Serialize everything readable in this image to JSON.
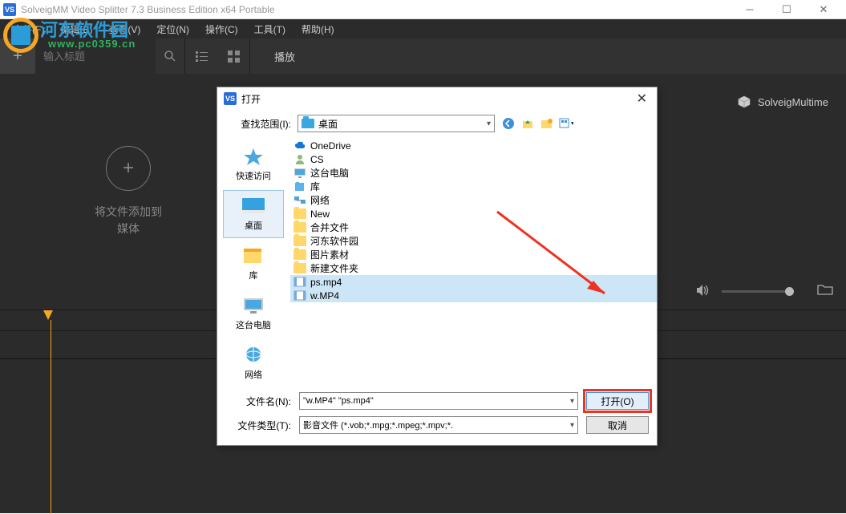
{
  "window": {
    "title": "SolveigMM Video Splitter 7.3 Business Edition x64 Portable"
  },
  "watermark": {
    "text1": "河东软件园",
    "text2": "www.pc0359.cn"
  },
  "menu": {
    "file": "文件(F)",
    "edit": "编辑(E)",
    "view": "查看(V)",
    "navigate": "定位(N)",
    "control": "操作(C)",
    "tools": "工具(T)",
    "help": "帮助(H)"
  },
  "toolbar": {
    "title_placeholder": "输入标题",
    "play": "播放"
  },
  "media": {
    "add_line1": "将文件添加到",
    "add_line2": "媒体"
  },
  "brand": "SolveigMultime",
  "dialog": {
    "title": "打开",
    "lookin_label": "查找范围(I):",
    "lookin_value": "桌面",
    "sidebar": {
      "quick": "快速访问",
      "desktop": "桌面",
      "library": "库",
      "pc": "这台电脑",
      "network": "网络"
    },
    "items": [
      {
        "name": "OneDrive",
        "type": "cloud"
      },
      {
        "name": "CS",
        "type": "user"
      },
      {
        "name": "这台电脑",
        "type": "pc"
      },
      {
        "name": "库",
        "type": "lib"
      },
      {
        "name": "网络",
        "type": "net"
      },
      {
        "name": "New",
        "type": "folder"
      },
      {
        "name": "合并文件",
        "type": "folder"
      },
      {
        "name": "河东软件园",
        "type": "folder"
      },
      {
        "name": "图片素材",
        "type": "folder"
      },
      {
        "name": "新建文件夹",
        "type": "folder"
      },
      {
        "name": "ps.mp4",
        "type": "video",
        "selected": true
      },
      {
        "name": "w.MP4",
        "type": "video",
        "selected": true
      }
    ],
    "filename_label": "文件名(N):",
    "filename_value": "\"w.MP4\" \"ps.mp4\"",
    "filetype_label": "文件类型(T):",
    "filetype_value": "影音文件 (*.vob;*.mpg;*.mpeg;*.mpv;*.",
    "open_btn": "打开(O)",
    "cancel_btn": "取消"
  }
}
